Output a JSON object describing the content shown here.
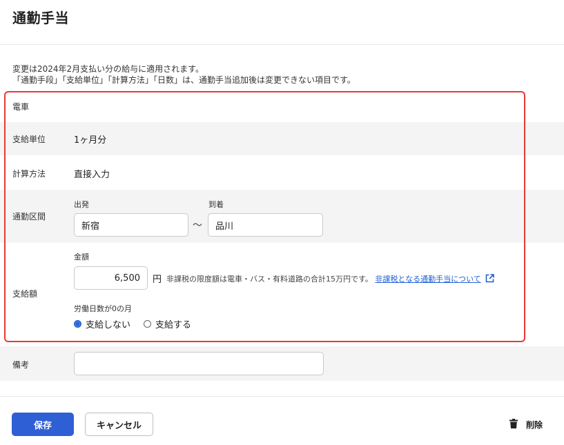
{
  "page": {
    "title": "通勤手当"
  },
  "notice": {
    "line1": "変更は2024年2月支払い分の給与に適用されます。",
    "line2": "「通勤手段」「支給単位」「計算方法」「日数」は、通勤手当追加後は変更できない項目です。"
  },
  "form": {
    "transport": {
      "value": "電車"
    },
    "pay_unit": {
      "label": "支給単位",
      "value": "1ヶ月分"
    },
    "calc_method": {
      "label": "計算方法",
      "value": "直接入力"
    },
    "route": {
      "label": "通勤区間",
      "departure_label": "出発",
      "departure_value": "新宿",
      "arrival_label": "到着",
      "arrival_value": "品川",
      "separator": "～"
    },
    "amount": {
      "label": "支給額",
      "amount_label": "金額",
      "amount_value": "6,500",
      "currency": "円",
      "note": "非課税の限度額は電車・バス・有料道路の合計15万円です。",
      "link": "非課税となる通勤手当について",
      "zero_days_label": "労働日数が0の月",
      "options": [
        {
          "label": "支給しない",
          "selected": true
        },
        {
          "label": "支給する",
          "selected": false
        }
      ]
    },
    "remarks": {
      "label": "備考",
      "value": ""
    }
  },
  "footer": {
    "save_label": "保存",
    "cancel_label": "キャンセル",
    "delete_label": "削除"
  },
  "colors": {
    "primary": "#2f5fd4",
    "link": "#1f5fd6",
    "highlight": "#e53935",
    "row_shade": "#f4f4f4"
  }
}
